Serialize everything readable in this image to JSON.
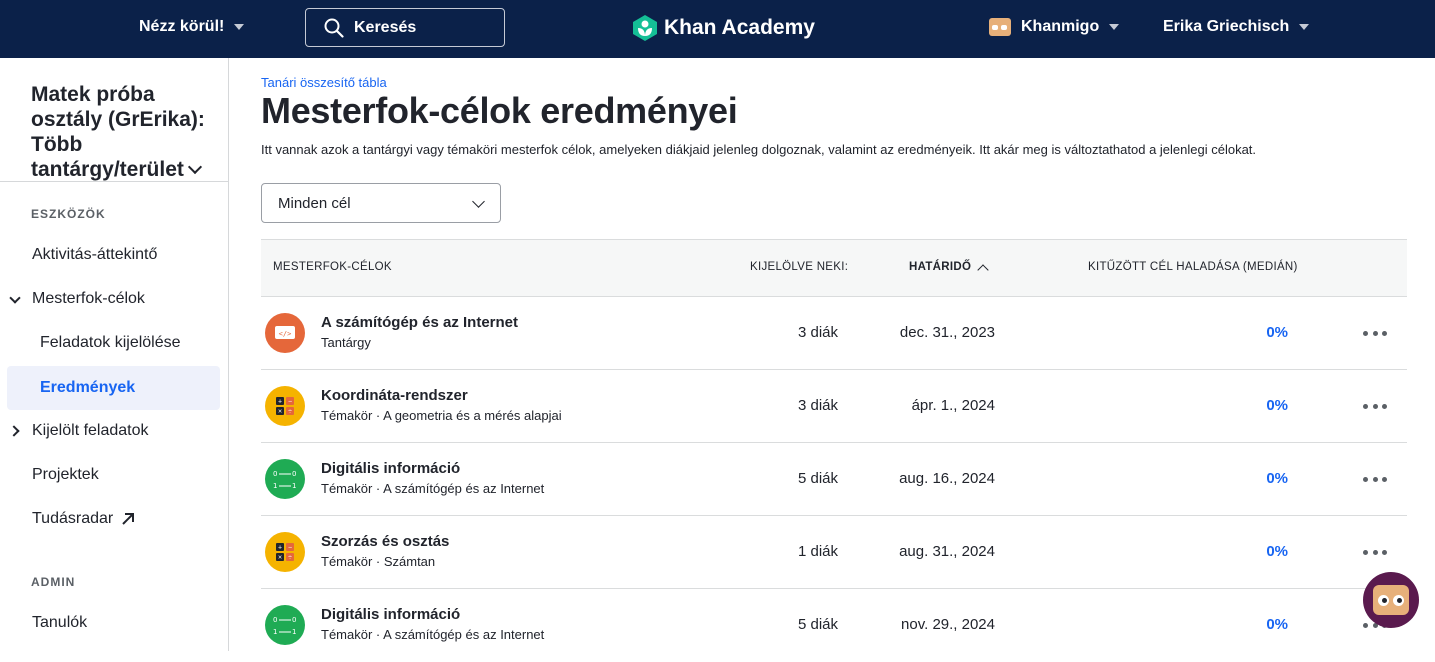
{
  "topbar": {
    "explore_label": "Nézz körül!",
    "search_placeholder": "Keresés",
    "logo_text": "Khan Academy",
    "khanmigo_label": "Khanmigo",
    "user_name": "Erika Griechisch"
  },
  "sidebar": {
    "class_title": "Matek próba osztály (GrErika): Több tantárgy/terület",
    "section_tools": "ESZKÖZÖK",
    "items": {
      "activity": "Aktivitás-áttekintő",
      "mastery_goals": "Mesterfok-célok",
      "assign_tasks": "Feladatok kijelölése",
      "results": "Eredmények",
      "assigned_tasks": "Kijelölt feladatok",
      "projects": "Projektek",
      "radar": "Tudásradar"
    },
    "section_admin": "ADMIN",
    "admin_items": {
      "students": "Tanulók"
    }
  },
  "main": {
    "breadcrumb": "Tanári összesítő tábla",
    "title": "Mesterfok-célok eredményei",
    "description": "Itt vannak azok a tantárgyi vagy témaköri mesterfok célok, amelyeken diákjaid jelenleg dolgoznak, valamint az eredményeik. Itt akár meg is változtathatod a jelenlegi célokat.",
    "filter_value": "Minden cél",
    "table": {
      "headers": {
        "goals": "MESTERFOK-CÉLOK",
        "assigned": "KIJELÖLVE NEKI:",
        "due": "HATÁRIDŐ",
        "progress": "KITŰZÖTT CÉL HALADÁSA (MEDIÁN)"
      },
      "rows": [
        {
          "icon": "computer-code-icon",
          "title": "A számítógép és az Internet",
          "subtitle": "Tantárgy",
          "assigned": "3 diák",
          "due": "dec. 31., 2023",
          "progress": "0%"
        },
        {
          "icon": "calculator-icon",
          "title": "Koordináta-rendszer",
          "subtitle": "Témakör · A geometria és a mérés alapjai",
          "assigned": "3 diák",
          "due": "ápr. 1., 2024",
          "progress": "0%"
        },
        {
          "icon": "binary-icon",
          "title": "Digitális információ",
          "subtitle": "Témakör · A számítógép és az Internet",
          "assigned": "5 diák",
          "due": "aug. 16., 2024",
          "progress": "0%"
        },
        {
          "icon": "calculator-icon",
          "title": "Szorzás és osztás",
          "subtitle": "Témakör · Számtan",
          "assigned": "1 diák",
          "due": "aug. 31., 2024",
          "progress": "0%"
        },
        {
          "icon": "binary-icon",
          "title": "Digitális információ",
          "subtitle": "Témakör · A számítógép és az Internet",
          "assigned": "5 diák",
          "due": "nov. 29., 2024",
          "progress": "0%"
        }
      ]
    }
  },
  "colors": {
    "nav_bg": "#0b2149",
    "accent_blue": "#1865f2",
    "icon_cs": "#e5673a",
    "icon_math": "#f5b300",
    "icon_dig": "#1fab54",
    "fab_bg": "#5a1a4e"
  }
}
